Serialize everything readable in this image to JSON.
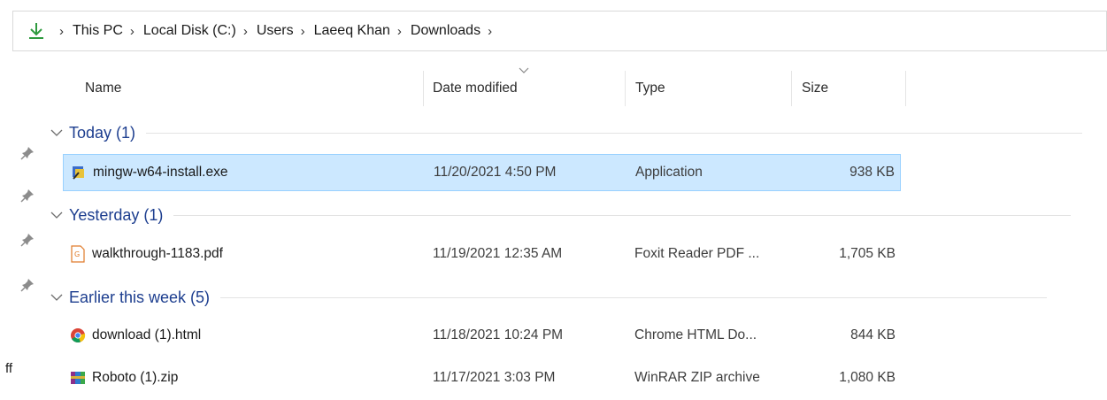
{
  "breadcrumb": {
    "items": [
      "This PC",
      "Local Disk (C:)",
      "Users",
      "Laeeq Khan",
      "Downloads"
    ],
    "separator": ">"
  },
  "columns": {
    "name": "Name",
    "date": "Date modified",
    "type": "Type",
    "size": "Size"
  },
  "groups": {
    "today": "Today (1)",
    "yesterday": "Yesterday (1)",
    "earlier": "Earlier this week (5)"
  },
  "files": [
    {
      "name": "mingw-w64-install.exe",
      "date": "11/20/2021 4:50 PM",
      "type": "Application",
      "size": "938 KB",
      "icon": "installer-icon",
      "selected": true
    },
    {
      "name": "walkthrough-1183.pdf",
      "date": "11/19/2021 12:35 AM",
      "type": "Foxit Reader PDF ...",
      "size": "1,705 KB",
      "icon": "pdf-file-icon",
      "selected": false
    },
    {
      "name": "download (1).html",
      "date": "11/18/2021 10:24 PM",
      "type": "Chrome HTML Do...",
      "size": "844 KB",
      "icon": "chrome-icon",
      "selected": false
    },
    {
      "name": "Roboto (1).zip",
      "date": "11/17/2021 3:03 PM",
      "type": "WinRAR ZIP archive",
      "size": "1,080 KB",
      "icon": "winrar-icon",
      "selected": false
    }
  ],
  "left_stray_text": "ff",
  "colors": {
    "group_label": "#1d3e8f",
    "selection_bg": "#cce8ff",
    "selection_border": "#99d1ff",
    "download_arrow": "#2e9a3e"
  }
}
